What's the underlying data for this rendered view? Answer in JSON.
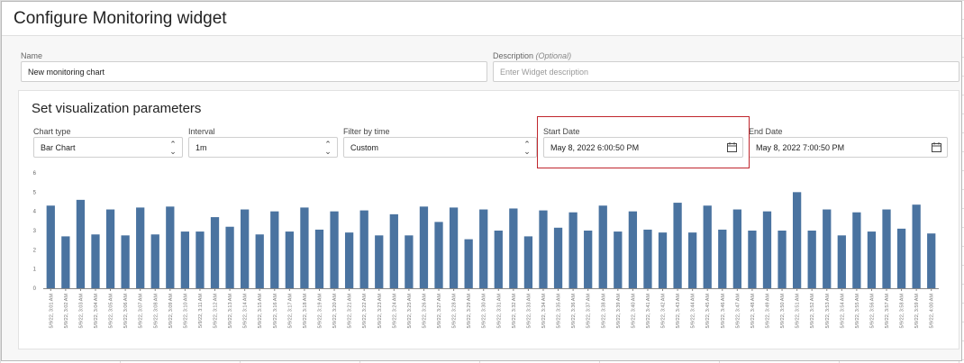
{
  "dialog": {
    "title": "Configure Monitoring widget"
  },
  "name_field": {
    "label": "Name",
    "value": "New monitoring chart"
  },
  "description_field": {
    "label": "Description",
    "optional": "(Optional)",
    "placeholder": "Enter Widget description"
  },
  "panel": {
    "title": "Set visualization parameters",
    "chart_type": {
      "label": "Chart type",
      "value": "Bar Chart"
    },
    "interval": {
      "label": "Interval",
      "value": "1m"
    },
    "filter": {
      "label": "Filter by time",
      "value": "Custom"
    },
    "start_date": {
      "label": "Start Date",
      "value": "May 8, 2022 6:00:50 PM"
    },
    "end_date": {
      "label": "End Date",
      "value": "May 8, 2022 7:00:50 PM"
    }
  },
  "colors": {
    "bar": "#4a73a0",
    "highlight": "#c0262d"
  },
  "chart_data": {
    "type": "bar",
    "ylim": [
      0,
      6
    ],
    "yticks": [
      0,
      1,
      2,
      3,
      4,
      5,
      6
    ],
    "grid": false,
    "categories": [
      "5/9/22, 3:01 AM",
      "5/9/22, 3:02 AM",
      "5/9/22, 3:03 AM",
      "5/9/22, 3:04 AM",
      "5/9/22, 3:05 AM",
      "5/9/22, 3:06 AM",
      "5/9/22, 3:07 AM",
      "5/9/22, 3:08 AM",
      "5/9/22, 3:09 AM",
      "5/9/22, 3:10 AM",
      "5/9/22, 3:11 AM",
      "5/9/22, 3:12 AM",
      "5/9/22, 3:13 AM",
      "5/9/22, 3:14 AM",
      "5/9/22, 3:15 AM",
      "5/9/22, 3:16 AM",
      "5/9/22, 3:17 AM",
      "5/9/22, 3:18 AM",
      "5/9/22, 3:19 AM",
      "5/9/22, 3:20 AM",
      "5/9/22, 3:21 AM",
      "5/9/22, 3:22 AM",
      "5/9/22, 3:23 AM",
      "5/9/22, 3:24 AM",
      "5/9/22, 3:25 AM",
      "5/9/22, 3:26 AM",
      "5/9/22, 3:27 AM",
      "5/9/22, 3:28 AM",
      "5/9/22, 3:29 AM",
      "5/9/22, 3:30 AM",
      "5/9/22, 3:31 AM",
      "5/9/22, 3:32 AM",
      "5/9/22, 3:33 AM",
      "5/9/22, 3:34 AM",
      "5/9/22, 3:35 AM",
      "5/9/22, 3:36 AM",
      "5/9/22, 3:37 AM",
      "5/9/22, 3:38 AM",
      "5/9/22, 3:39 AM",
      "5/9/22, 3:40 AM",
      "5/9/22, 3:41 AM",
      "5/9/22, 3:42 AM",
      "5/9/22, 3:43 AM",
      "5/9/22, 3:44 AM",
      "5/9/22, 3:45 AM",
      "5/9/22, 3:46 AM",
      "5/9/22, 3:47 AM",
      "5/9/22, 3:48 AM",
      "5/9/22, 3:49 AM",
      "5/9/22, 3:50 AM",
      "5/9/22, 3:51 AM",
      "5/9/22, 3:52 AM",
      "5/9/22, 3:53 AM",
      "5/9/22, 3:54 AM",
      "5/9/22, 3:55 AM",
      "5/9/22, 3:56 AM",
      "5/9/22, 3:57 AM",
      "5/9/22, 3:58 AM",
      "5/9/22, 3:59 AM",
      "5/9/22, 4:00 AM"
    ],
    "values": [
      4.3,
      2.7,
      4.6,
      2.8,
      4.1,
      2.75,
      4.2,
      2.8,
      4.25,
      2.95,
      2.95,
      3.7,
      3.2,
      4.1,
      2.8,
      4.0,
      2.95,
      4.2,
      3.05,
      4.0,
      2.9,
      4.05,
      2.75,
      3.85,
      2.75,
      4.25,
      3.45,
      4.2,
      2.55,
      4.1,
      3.0,
      4.15,
      2.7,
      4.05,
      3.15,
      3.95,
      3.0,
      4.3,
      2.95,
      4.0,
      3.05,
      2.9,
      4.45,
      2.9,
      4.3,
      3.05,
      4.1,
      3.0,
      4.0,
      3.0,
      5.0,
      3.0,
      4.1,
      2.75,
      3.95,
      2.95,
      4.1,
      3.1,
      4.35,
      2.85
    ]
  }
}
